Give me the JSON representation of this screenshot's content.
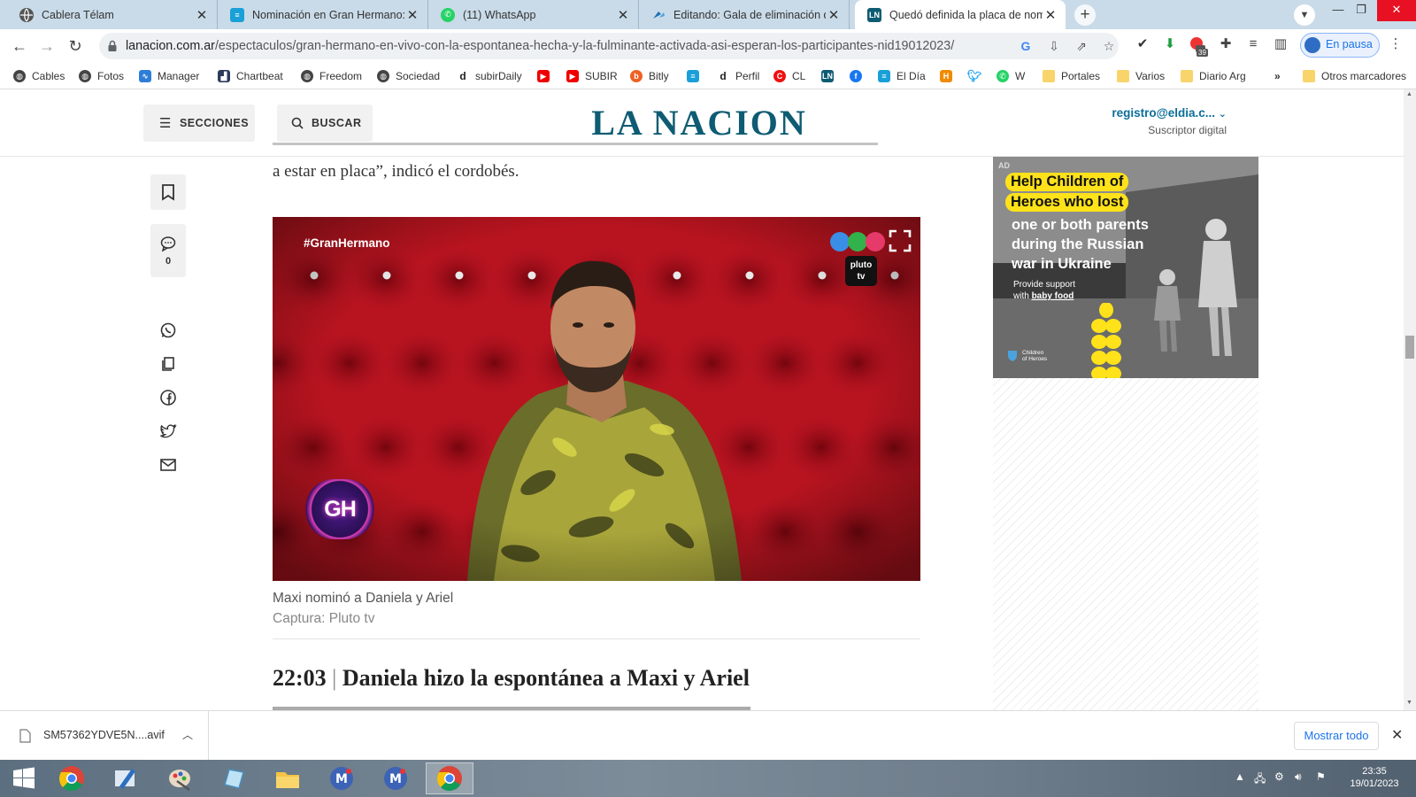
{
  "browser": {
    "tabs": [
      {
        "title": "Cablera Télam",
        "favicon": "globe-icon"
      },
      {
        "title": "Nominación en Gran Hermano: s",
        "favicon": "eldia-icon"
      },
      {
        "title": "(11) WhatsApp",
        "favicon": "whatsapp-icon"
      },
      {
        "title": "Editando: Gala de eliminación de",
        "favicon": "editor-icon"
      },
      {
        "title": "Quedó definida la placa de nomi",
        "favicon": "lanacion-icon",
        "active": true
      }
    ],
    "url_host": "lanacion.com.ar",
    "url_path": "/espectaculos/gran-hermano-en-vivo-con-la-espontanea-hecha-y-la-fulminante-activada-asi-esperan-los-participantes-nid19012023/",
    "pause_label": "En pausa",
    "extension_badge": "39",
    "bookmarks": [
      {
        "label": "Cables",
        "icon": "globe-icon"
      },
      {
        "label": "Fotos",
        "icon": "globe-icon"
      },
      {
        "label": "Manager",
        "icon": "manager-icon"
      },
      {
        "label": "Chartbeat",
        "icon": "chartbeat-icon"
      },
      {
        "label": "Freedom",
        "icon": "globe-icon"
      },
      {
        "label": "Sociedad",
        "icon": "globe-icon"
      },
      {
        "label": "subirDaily",
        "icon": "d-icon"
      },
      {
        "label": "",
        "icon": "youtube-icon"
      },
      {
        "label": "SUBIR",
        "icon": "youtube-icon"
      },
      {
        "label": "Bitly",
        "icon": "bitly-icon"
      },
      {
        "label": "",
        "icon": "eldia-icon"
      },
      {
        "label": "Perfil",
        "icon": "d-icon"
      },
      {
        "label": "CL",
        "icon": "cl-icon"
      },
      {
        "label": "",
        "icon": "lanacion-icon"
      },
      {
        "label": "",
        "icon": "facebook-icon"
      },
      {
        "label": "El Día",
        "icon": "eldia-icon"
      },
      {
        "label": "",
        "icon": "orange-icon"
      },
      {
        "label": "",
        "icon": "twitter-icon"
      },
      {
        "label": "W",
        "icon": "whatsapp-icon"
      },
      {
        "label": "Portales",
        "icon": "folder-icon"
      },
      {
        "label": "Varios",
        "icon": "folder-icon"
      },
      {
        "label": "Diario Arg",
        "icon": "folder-icon"
      }
    ],
    "more_bookmarks": "»",
    "other_bookmarks": "Otros marcadores"
  },
  "site": {
    "sections_label": "SECCIONES",
    "search_label": "BUSCAR",
    "brand": "LA NACION",
    "account_email": "registro@eldia.c...",
    "account_role": "Suscriptor digital"
  },
  "article": {
    "quote_tail": "a estar en placa”, indicó el cordobés.",
    "comments_count": "0",
    "video_hashtag": "#GranHermano",
    "video_channel": "pluto tv",
    "video_logo": "GH",
    "caption": "Maxi nominó a Daniela y Ariel",
    "credit": "Captura: Pluto tv",
    "update_time": "22:03",
    "update_title": "Daniela hizo la espontánea a Maxi y Ariel"
  },
  "ad": {
    "badge": "AD",
    "headline_lines": [
      "Help Children of",
      "Heroes who lost"
    ],
    "body_lines": [
      "one or both parents",
      "during the Russian",
      "war in Ukraine"
    ],
    "cta_line1": "Provide support",
    "cta_prefix": "with ",
    "cta_link": "baby food",
    "org_line1": "Children",
    "org_line2": "of Heroes"
  },
  "downloads": {
    "file_name": "SM57362YDVE5N....avif",
    "show_all_label": "Mostrar todo"
  },
  "taskbar": {
    "time": "23:35",
    "date": "19/01/2023"
  },
  "colors": {
    "brand": "#0e5c73",
    "link": "#0b6f99",
    "chrome_tabstrip": "#c9dbe8",
    "video_bg": "#b2111f",
    "ad_yellow": "#ffe21a"
  }
}
